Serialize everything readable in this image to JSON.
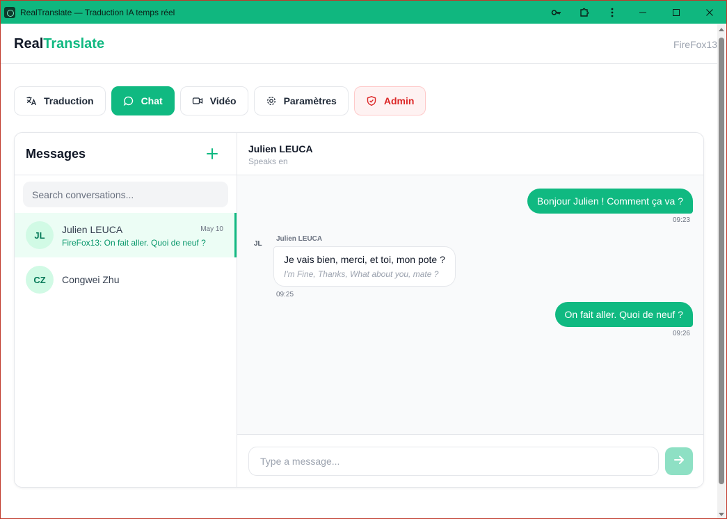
{
  "window": {
    "title": "RealTranslate — Traduction IA temps réel",
    "controls": [
      "key-icon",
      "extension-icon",
      "more-icon",
      "minimize-icon",
      "maximize-icon",
      "close-icon"
    ]
  },
  "header": {
    "brand_part1": "Real",
    "brand_part2": "Translate",
    "user": "FireFox13"
  },
  "tabs": [
    {
      "label": "Traduction",
      "icon": "translate-icon",
      "active": false
    },
    {
      "label": "Chat",
      "icon": "chat-icon",
      "active": true
    },
    {
      "label": "Vidéo",
      "icon": "video-icon",
      "active": false
    },
    {
      "label": "Paramètres",
      "icon": "gear-icon",
      "active": false
    },
    {
      "label": "Admin",
      "icon": "shield-icon",
      "active": false
    }
  ],
  "sidebar": {
    "title": "Messages",
    "search_placeholder": "Search conversations...",
    "conversations": [
      {
        "initials": "JL",
        "name": "Julien LEUCA",
        "date": "May 10",
        "preview": "FireFox13: On fait aller. Quoi de neuf ?",
        "active": true
      },
      {
        "initials": "CZ",
        "name": "Congwei Zhu",
        "date": "",
        "preview": "",
        "active": false
      }
    ]
  },
  "chat": {
    "contact_name": "Julien LEUCA",
    "contact_lang": "Speaks en",
    "messages": [
      {
        "direction": "out",
        "text": "Bonjour Julien ! Comment ça va ?",
        "time": "09:23"
      },
      {
        "direction": "in",
        "sender": "Julien LEUCA",
        "initials": "JL",
        "text": "Je vais bien, merci, et toi, mon pote ?",
        "translation": "I'm Fine, Thanks, What about you, mate ?",
        "time": "09:25"
      },
      {
        "direction": "out",
        "text": "On fait aller. Quoi de neuf ?",
        "time": "09:26"
      }
    ],
    "input_placeholder": "Type a message...",
    "send_label": "send"
  },
  "colors": {
    "accent": "#10b981",
    "titlebar": "#10b77f",
    "admin": "#dc2626"
  }
}
